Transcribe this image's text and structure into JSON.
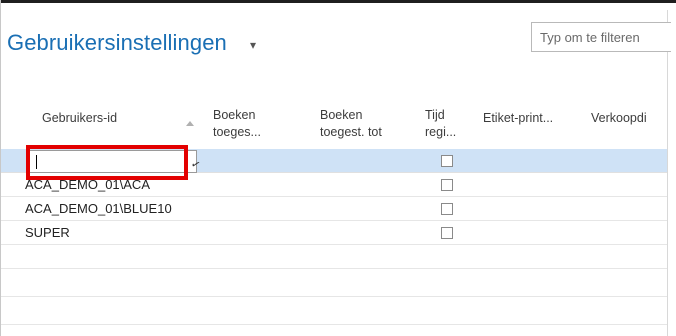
{
  "page": {
    "title": "Gebruikersinstellingen",
    "title_menu_icon": "chevron-down-icon",
    "filter_placeholder": "Typ om te filteren"
  },
  "columns": [
    {
      "label": "Gebruikers-id",
      "sort": "ascending"
    },
    {
      "label": "Boeken toeges..."
    },
    {
      "label": "Boeken toegest. tot"
    },
    {
      "label": "Tijd regi..."
    },
    {
      "label": "Etiket-print..."
    },
    {
      "label": "Verkoopdi"
    }
  ],
  "rows": [
    {
      "user_id": "",
      "time_registration": false,
      "selected": true,
      "editing": true
    },
    {
      "user_id": "ACA_DEMO_01\\ACA",
      "time_registration": false
    },
    {
      "user_id": "ACA_DEMO_01\\BLUE10",
      "time_registration": false
    },
    {
      "user_id": "SUPER",
      "time_registration": false
    }
  ],
  "colors": {
    "title": "#1a6fb4",
    "selected_row": "#cfe2f6",
    "highlight": "#e30000"
  }
}
